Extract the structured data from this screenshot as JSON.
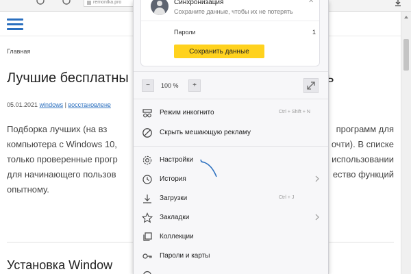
{
  "browser": {
    "address_text": "remontka.pro",
    "colors": {
      "accent": "#2a6fbf",
      "save_button": "#ffd21e"
    }
  },
  "page": {
    "breadcrumb": "Главная",
    "article_title": "Лучшие бесплатны… ь",
    "title_left": "Лучшие бесплатны",
    "title_right": "ь",
    "date": "05.01.2021",
    "tags": [
      "windows",
      "восстановлене"
    ],
    "paragraph_lines": [
      {
        "left": "Подборка лучших (на вз",
        "right": "программ для"
      },
      {
        "left": "компьютера с Windows 10,",
        "right": "очти). В списке"
      },
      {
        "left": "только проверенные прогр",
        "right": "использовании"
      },
      {
        "left": "для начинающего пользов",
        "right": "ество функций"
      },
      {
        "left": "опытному.",
        "right": ""
      }
    ],
    "section_title": "Установка Window"
  },
  "menu": {
    "sync": {
      "title": "Синхронизация",
      "subtitle": "Сохраните данные, чтобы их не потерять",
      "passwords_label": "Пароли",
      "passwords_count": "1",
      "save_button": "Сохранить данные"
    },
    "zoom": {
      "minus": "−",
      "value": "100 %",
      "plus": "+"
    },
    "items": [
      {
        "label": "Режим инкогнито",
        "shortcut": "Ctrl + Shift + N",
        "icon": "incognito-icon"
      },
      {
        "label": "Скрыть мешающую рекламу",
        "shortcut": "",
        "icon": "block-ads-icon"
      },
      {
        "label": "Настройки",
        "shortcut": "",
        "icon": "gear-icon"
      },
      {
        "label": "История",
        "shortcut": "",
        "icon": "history-icon"
      },
      {
        "label": "Загрузки",
        "shortcut": "Ctrl + J",
        "icon": "download-icon"
      },
      {
        "label": "Закладки",
        "shortcut": "",
        "icon": "star-icon"
      },
      {
        "label": "Коллекции",
        "shortcut": "",
        "icon": "collections-icon"
      },
      {
        "label": "Пароли и карты",
        "shortcut": "",
        "icon": "key-icon"
      }
    ]
  }
}
